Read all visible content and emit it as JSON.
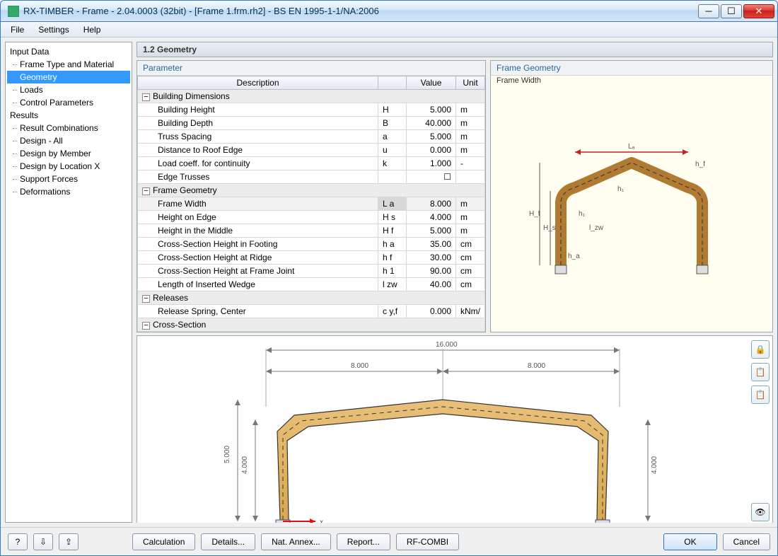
{
  "window": {
    "title": "RX-TIMBER - Frame - 2.04.0003 (32bit) - [Frame 1.frm.rh2] - BS EN 1995-1-1/NA:2006"
  },
  "menu": {
    "file": "File",
    "settings": "Settings",
    "help": "Help"
  },
  "sidebar": {
    "input_head": "Input Data",
    "items_input": [
      "Frame Type and Material",
      "Geometry",
      "Loads",
      "Control Parameters"
    ],
    "results_head": "Results",
    "items_results": [
      "Result Combinations",
      "Design - All",
      "Design by Member",
      "Design by Location X",
      "Support Forces",
      "Deformations"
    ]
  },
  "panel": {
    "title": "1.2 Geometry",
    "param_label": "Parameter",
    "cols": {
      "desc": "Description",
      "value": "Value",
      "unit": "Unit"
    },
    "groups": {
      "g1": "Building Dimensions",
      "g2": "Frame Geometry",
      "g3": "Releases",
      "g4": "Cross-Section"
    },
    "rows": [
      {
        "d": "Building Height",
        "s": "H",
        "v": "5.000",
        "u": "m"
      },
      {
        "d": "Building Depth",
        "s": "B",
        "v": "40.000",
        "u": "m"
      },
      {
        "d": "Truss Spacing",
        "s": "a",
        "v": "5.000",
        "u": "m"
      },
      {
        "d": "Distance to Roof Edge",
        "s": "u",
        "v": "0.000",
        "u": "m"
      },
      {
        "d": "Load coeff. for continuity",
        "s": "k",
        "v": "1.000",
        "u": "-"
      },
      {
        "d": "Edge Trusses",
        "s": "",
        "v": "☐",
        "u": ""
      },
      {
        "d": "Frame Width",
        "s": "L a",
        "v": "8.000",
        "u": "m"
      },
      {
        "d": "Height on Edge",
        "s": "H s",
        "v": "4.000",
        "u": "m"
      },
      {
        "d": "Height in the Middle",
        "s": "H f",
        "v": "5.000",
        "u": "m"
      },
      {
        "d": "Cross-Section Height in Footing",
        "s": "h a",
        "v": "35.00",
        "u": "cm"
      },
      {
        "d": "Cross-Section Height at Ridge",
        "s": "h f",
        "v": "30.00",
        "u": "cm"
      },
      {
        "d": "Cross-Section Height at Frame Joint",
        "s": "h 1",
        "v": "90.00",
        "u": "cm"
      },
      {
        "d": "Length of Inserted Wedge",
        "s": "l zw",
        "v": "40.00",
        "u": "cm"
      },
      {
        "d": "Release Spring, Center",
        "s": "c y,f",
        "v": "0.000",
        "u": "kNm/"
      }
    ]
  },
  "preview": {
    "head": "Frame Geometry",
    "sub": "Frame Width",
    "labels": {
      "La": "Lₐ",
      "hf": "h_f",
      "Hf": "H_f",
      "Hs": "H_s",
      "h1": "h₁",
      "lzw": "l_zw",
      "ha": "h_a"
    }
  },
  "drawing": {
    "dims": {
      "total": "16.000",
      "half": "8.000",
      "height": "5.000",
      "edge": "4.000"
    },
    "axis_x": "x"
  },
  "buttons": {
    "calc": "Calculation",
    "details": "Details...",
    "annex": "Nat. Annex...",
    "report": "Report...",
    "rfcombi": "RF-COMBI",
    "ok": "OK",
    "cancel": "Cancel"
  }
}
